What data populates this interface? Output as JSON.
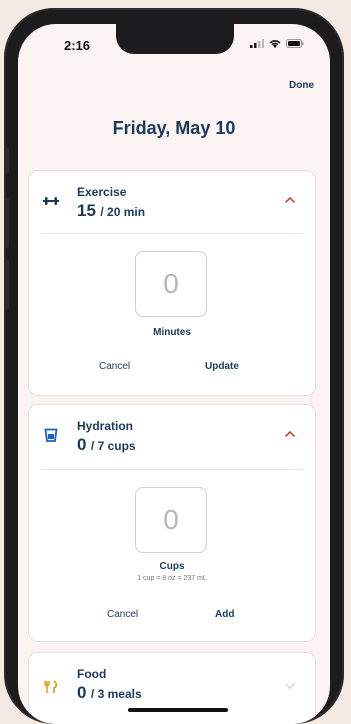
{
  "status": {
    "time": "2:16"
  },
  "header": {
    "done_label": "Done",
    "date": "Friday, May 10"
  },
  "exercise": {
    "title": "Exercise",
    "value": "15",
    "goal": "/ 20 min",
    "input_value": "0",
    "input_label": "Minutes",
    "cancel_label": "Cancel",
    "update_label": "Update"
  },
  "hydration": {
    "title": "Hydration",
    "value": "0",
    "goal": "/ 7 cups",
    "input_value": "0",
    "input_label": "Cups",
    "input_note": "1 cup = 8 oz = 237 mL",
    "cancel_label": "Cancel",
    "add_label": "Add"
  },
  "food": {
    "title": "Food",
    "value": "0",
    "goal": "/ 3 meals"
  },
  "colors": {
    "accent": "#1b3a5b",
    "chevron": "#c0392b",
    "food_icon": "#d89a00"
  }
}
